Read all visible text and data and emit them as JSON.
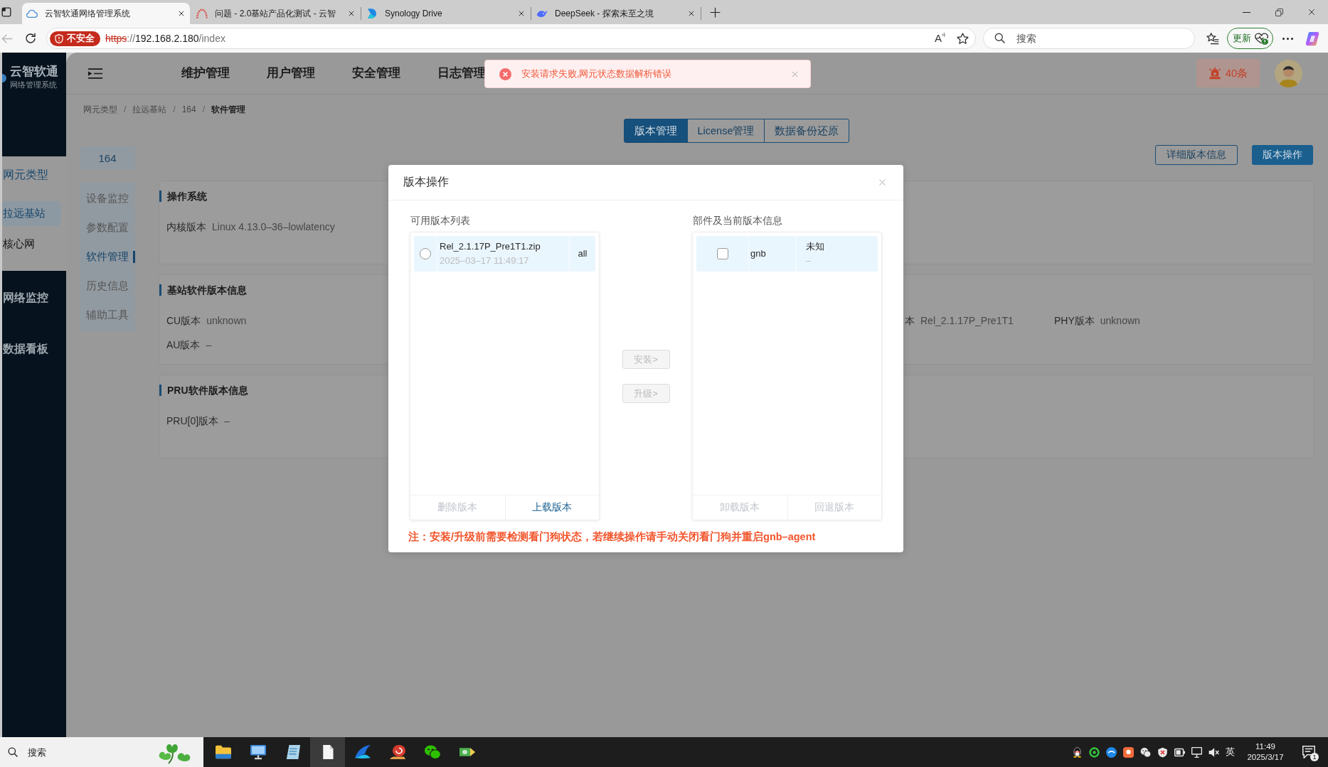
{
  "browser": {
    "tabs": [
      {
        "kind": "cloud",
        "title": "云智软通网络管理系统",
        "selected": true
      },
      {
        "kind": "arc",
        "title": "问题 - 2.0基站产品化测试 - 云智",
        "selected": false
      },
      {
        "kind": "drive",
        "title": "Synology Drive",
        "selected": false
      },
      {
        "kind": "whale",
        "title": "DeepSeek - 探索未至之境",
        "selected": false
      }
    ],
    "security_badge": "不安全",
    "url_parts": [
      {
        "kind": "insecure",
        "text": "https"
      },
      {
        "kind": "dim",
        "text": "://"
      },
      {
        "kind": "host",
        "text": "192.168.2.180"
      },
      {
        "kind": "dim",
        "text": "/index"
      }
    ],
    "read_aloud": "A",
    "search": {
      "placeholder": "搜索"
    },
    "update_button": "更新"
  },
  "toast": {
    "kind": "error",
    "message": "安装请求失败,网元状态数据解析错误"
  },
  "app": {
    "logo": {
      "title": "云智软通",
      "subtitle": "网络管理系统"
    },
    "sidebar": [
      {
        "label": "网元类型",
        "expanded": true,
        "children": [
          {
            "label": "拉远基站",
            "selected": true
          },
          {
            "label": "核心网",
            "selected": false
          }
        ]
      },
      {
        "label": "网络监控",
        "expanded": false
      },
      {
        "label": "数据看板",
        "expanded": false
      }
    ],
    "nav": [
      "维护管理",
      "用户管理",
      "安全管理",
      "日志管理"
    ],
    "alarm": "40条",
    "breadcrumb": [
      {
        "kind": "link",
        "text": "网元类型"
      },
      {
        "kind": "separator",
        "text": "/"
      },
      {
        "kind": "link",
        "text": "拉远基站"
      },
      {
        "kind": "separator",
        "text": "/"
      },
      {
        "kind": "link",
        "text": "164"
      },
      {
        "kind": "separator",
        "text": "/"
      },
      {
        "kind": "current",
        "text": "软件管理"
      }
    ],
    "node": {
      "title": "164",
      "menu": [
        {
          "label": "设备监控",
          "selected": false
        },
        {
          "label": "参数配置",
          "selected": false
        },
        {
          "label": "软件管理",
          "selected": true
        },
        {
          "label": "历史信息",
          "selected": false
        },
        {
          "label": "辅助工具",
          "selected": false
        }
      ]
    },
    "view_tabs": [
      {
        "label": "版本管理",
        "selected": true
      },
      {
        "label": "License管理",
        "selected": false
      },
      {
        "label": "数据备份还原",
        "selected": false
      }
    ],
    "actions": [
      {
        "kind": "outline",
        "label": "详细版本信息"
      },
      {
        "kind": "primary",
        "label": "版本操作"
      }
    ],
    "cards": [
      {
        "title": "操作系统",
        "rows": [
          [
            {
              "label": "内核版本",
              "value": "Linux 4.13.0–36–lowlatency"
            }
          ]
        ]
      },
      {
        "title": "基站软件版本信息",
        "rows": [
          [
            {
              "label": "CU版本",
              "value": "unknown"
            },
            {
              "label": "本",
              "value": "Rel_2.1.17P_Pre1T1"
            },
            {
              "label": "PHY版本",
              "value": "unknown"
            }
          ],
          [
            {
              "label": "AU版本",
              "value": "–"
            }
          ]
        ]
      },
      {
        "title": "PRU软件版本信息",
        "rows": [
          [
            {
              "label": "PRU[0]版本",
              "value": "–"
            }
          ]
        ]
      }
    ]
  },
  "dialog": {
    "title": "版本操作",
    "available": {
      "label": "可用版本列表",
      "items": [
        {
          "name": "Rel_2.1.17P_Pre1T1.zip",
          "date": "2025–03–17 11:49:17",
          "target": "all",
          "selected": false
        }
      ],
      "footer": [
        {
          "label": "删除版本",
          "disabled": true
        },
        {
          "label": "上载版本",
          "disabled": false
        }
      ]
    },
    "transfer_buttons": [
      {
        "label": "安装>",
        "disabled": true
      },
      {
        "label": "升级>",
        "disabled": true
      }
    ],
    "components": {
      "label": "部件及当前版本信息",
      "items": [
        {
          "name": "gnb",
          "status": "未知",
          "version": "–",
          "checked": false
        }
      ],
      "footer": [
        {
          "label": "卸载版本",
          "disabled": true
        },
        {
          "label": "回退版本",
          "disabled": true
        }
      ]
    },
    "note": "注：安装/升级前需要检测看门狗状态，若继续操作请手动关闭看门狗并重启gnb–agent"
  },
  "taskbar": {
    "search": {
      "placeholder": "搜索"
    },
    "apps": [
      {
        "kind": "folder",
        "selected": false
      },
      {
        "kind": "computer",
        "selected": false
      },
      {
        "kind": "notepad",
        "selected": false
      },
      {
        "kind": "document",
        "selected": true
      },
      {
        "kind": "swoosh",
        "selected": false
      },
      {
        "kind": "snail",
        "selected": false
      },
      {
        "kind": "chat",
        "selected": false
      },
      {
        "kind": "gem",
        "selected": false
      }
    ],
    "language": "英",
    "time": "11:49",
    "date": "2025/3/17",
    "notification_count": "1"
  }
}
